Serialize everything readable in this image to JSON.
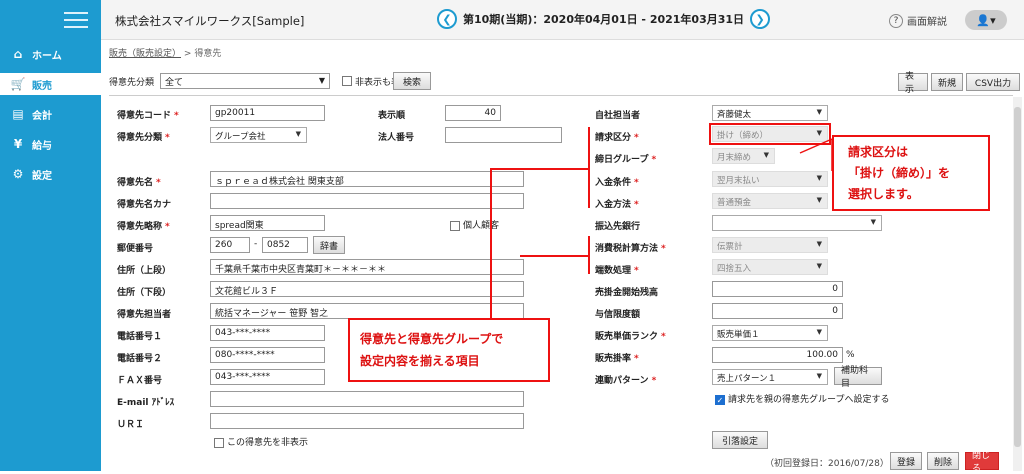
{
  "app": {
    "company": "株式会社スマイルワークス[Sample]"
  },
  "period": {
    "text": "第10期(当期)：2020年04月01日 - 2021年03月31日",
    "prev": "❮",
    "next": "❯"
  },
  "help_label": "画面解説",
  "user_icon": "👤▾",
  "sidebar": {
    "items": [
      {
        "label": "ホーム",
        "icon": "⌂"
      },
      {
        "label": "販売",
        "icon": "🛒"
      },
      {
        "label": "会計",
        "icon": "▤"
      },
      {
        "label": "給与",
        "icon": "¥"
      },
      {
        "label": "設定",
        "icon": "⚙"
      }
    ]
  },
  "breadcrumb": {
    "parent": "販売（販売設定）",
    "sep": ">",
    "current": "得意先"
  },
  "filter": {
    "label": "得意先分類",
    "value": "全て",
    "hidden_label": "非表示も表示",
    "search": "検索"
  },
  "toolbar": {
    "show": "表示",
    "new": "新規",
    "csv": "CSV出力"
  },
  "form": {
    "code_label": "得意先コード",
    "code": "gp20011",
    "order_label": "表示順",
    "order": "40",
    "class_label": "得意先分類",
    "class": "グループ会社",
    "corp_no_label": "法人番号",
    "corp_no": "",
    "name_label": "得意先名",
    "name": "ｓｐｒｅａｄ株式会社 関東支部",
    "kana_label": "得意先名カナ",
    "kana": "",
    "short_label": "得意先略称",
    "short": "spread関東",
    "personal_label": "個人顧客",
    "zip_label": "郵便番号",
    "zip1": "260",
    "zip_sep": "-",
    "zip2": "0852",
    "dict": "辞書",
    "addr1_label": "住所（上段）",
    "addr1": "千葉県千葉市中央区青葉町＊－＊＊－＊＊",
    "addr2_label": "住所（下段）",
    "addr2": "文花館ビル３Ｆ",
    "person_label": "得意先担当者",
    "person": "統括マネージャー 笹野 智之",
    "tel1_label": "電話番号１",
    "tel1": "043-***-****",
    "tel2_label": "電話番号２",
    "tel2": "080-****-****",
    "fax_label": "ＦＡＸ番号",
    "fax": "043-***-****",
    "email_label": "E-mail ｱﾄﾞﾚｽ",
    "email": "",
    "uri_label": "ＵＲＩ",
    "uri": "",
    "hide_label": "この得意先を非表示",
    "staff_label": "自社担当者",
    "staff": "斉藤健太",
    "bill_label": "請求区分",
    "bill": "掛け（締め）",
    "close_label": "締日グループ",
    "close": "月末締め",
    "payterm_label": "入金条件",
    "payterm": "翌月末払い",
    "paymethod_label": "入金方法",
    "paymethod": "普通預金",
    "bank_label": "振込先銀行",
    "bank": "",
    "tax_label": "消費税計算方法",
    "tax": "伝票計",
    "round_label": "端数処理",
    "round": "四捨五入",
    "balance_label": "売掛金開始残高",
    "balance": "0",
    "credit_label": "与信限度額",
    "credit": "0",
    "rank_label": "販売単価ランク",
    "rank": "販売単価１",
    "rate_label": "販売掛率",
    "rate": "100.00",
    "rate_unit": "%",
    "link_label": "連動パターン",
    "link": "売上パターン１",
    "aux": "補助科目",
    "parent_label": "請求先を親の得意先グループへ設定する",
    "debit": "引落設定",
    "reg_date": "（初回登録日：2016/07/28）"
  },
  "footer": {
    "register": "登録",
    "delete": "削除",
    "close": "閉じる"
  },
  "callout1": {
    "line1": "請求区分は",
    "line2": "「掛け（締め）」を",
    "line3": "選択します。"
  },
  "callout2": {
    "line1": "得意先と得意先グループで",
    "line2": "設定内容を揃える項目"
  },
  "colors": {
    "accent": "#1d9bd0",
    "annotation": "#e11111",
    "close_btn": "#e03a3a"
  }
}
